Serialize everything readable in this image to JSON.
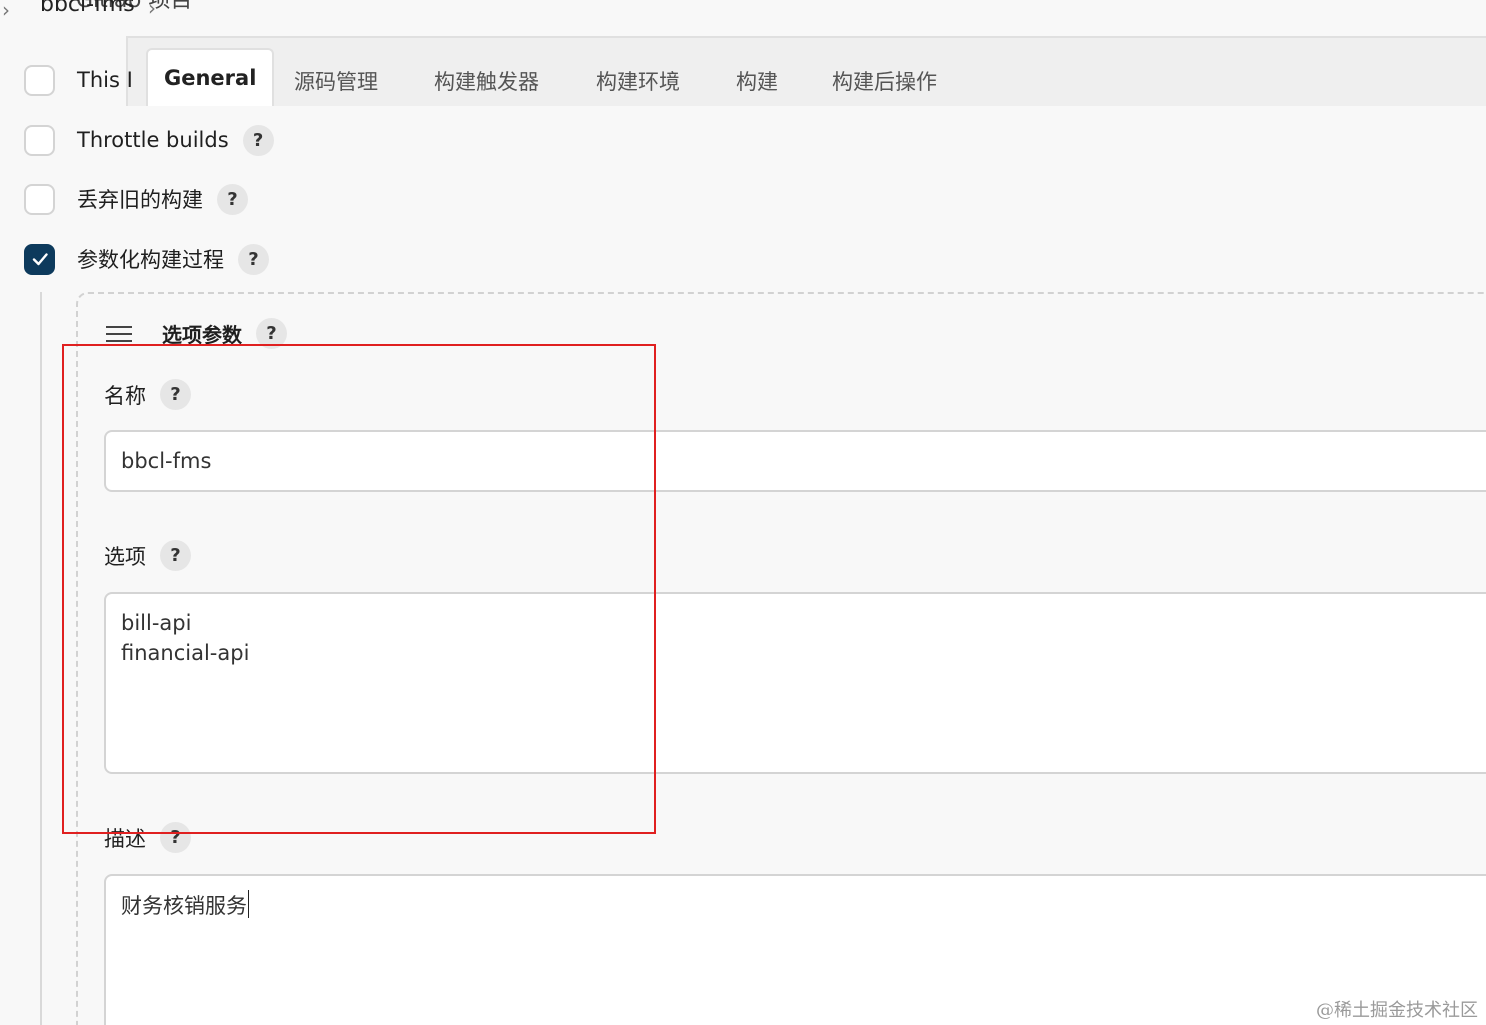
{
  "breadcrumb": {
    "project": "bbcl-fms",
    "overlap_text": "Gitlab 项目"
  },
  "options": [
    {
      "label": "This I",
      "checked": false,
      "has_help": false
    },
    {
      "label": "Throttle builds",
      "checked": false,
      "has_help": true
    },
    {
      "label": "丢弃旧的构建",
      "checked": false,
      "has_help": true
    },
    {
      "label": "参数化构建过程",
      "checked": true,
      "has_help": true
    }
  ],
  "help_symbol": "?",
  "tabs": {
    "general": "General",
    "scm": "源码管理",
    "triggers": "构建触发器",
    "env": "构建环境",
    "build": "构建",
    "post": "构建后操作",
    "active": "General"
  },
  "param_section": {
    "title": "选项参数",
    "name_label": "名称",
    "name_value": "bbcl-fms",
    "choices_label": "选项",
    "choices_value": "bill-api\nfinancial-api",
    "description_label": "描述",
    "description_value": "财务核销服务"
  },
  "watermark": "@稀土掘金技术社区",
  "colors": {
    "checked_box": "#0d3a5c",
    "highlight_border": "#e02020",
    "background": "#f8f8f8"
  }
}
